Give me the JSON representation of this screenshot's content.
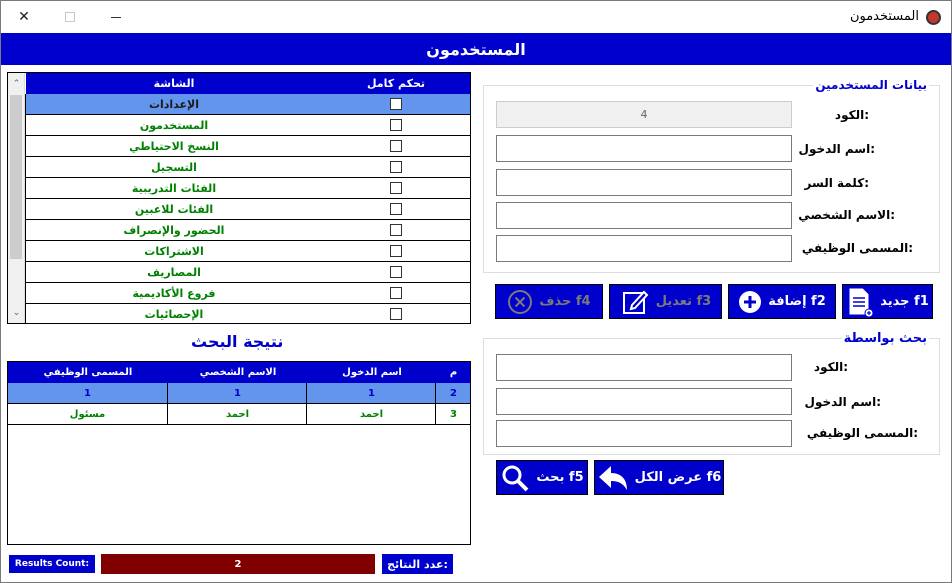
{
  "window": {
    "title": "المستخدمون",
    "close_glyph": "✕"
  },
  "header": {
    "title": "المستخدمون"
  },
  "permissions_grid": {
    "columns": {
      "screen": "الشاشة",
      "full_control": "تحكم كامل"
    },
    "rows": [
      {
        "screen": "الإعدادات",
        "selected": true
      },
      {
        "screen": "المستخدمون"
      },
      {
        "screen": "النسخ الاحتياطي"
      },
      {
        "screen": "التسجيل"
      },
      {
        "screen": "الفئات التدريبية"
      },
      {
        "screen": "الفئات للاعبين"
      },
      {
        "screen": "الحضور والإنصراف"
      },
      {
        "screen": "الاشتراكات"
      },
      {
        "screen": "المصاريف"
      },
      {
        "screen": "فروع الأكاديمية"
      },
      {
        "screen": "الإحصائيات"
      }
    ],
    "scroll_up_glyph": "⌃",
    "scroll_down_glyph": "⌄"
  },
  "search_result": {
    "title": "نتيجة البحث",
    "columns": {
      "job_title": "المسمى الوظيفي",
      "personal_name": "الاسم الشخصي",
      "login_name": "اسم الدخول",
      "index": "م"
    },
    "rows": [
      {
        "job_title": "1",
        "personal_name": "1",
        "login_name": "1",
        "index": "2",
        "selected": true
      },
      {
        "job_title": "مسئول",
        "personal_name": "احمد",
        "login_name": "احمد",
        "index": "3"
      }
    ]
  },
  "footer": {
    "results_count_label": "Results Count:",
    "results_count_value": "2",
    "results_count_ar": "عدد النتائج:"
  },
  "user_data": {
    "group_title": "بيانات المستخدمين",
    "code_label": "الكود:",
    "code_value": "4",
    "login_label": "اسم الدخول:",
    "password_label": "كلمة السر:",
    "personal_name_label": "الاسم الشخصي:",
    "job_title_label": "المسمى الوظيفي:"
  },
  "actions": {
    "new": "جديد f1",
    "add": "إضافة f2",
    "edit": "تعديل f3",
    "delete": "حذف f4"
  },
  "search_by": {
    "group_title": "بحث بواسطة",
    "code_label": "الكود:",
    "login_label": "اسم الدخول:",
    "job_title_label": "المسمى الوظيفي:"
  },
  "search_actions": {
    "show_all": "عرض الكل f6",
    "search": "بحث f5"
  },
  "colors": {
    "primary": "#0000cd",
    "selected_row": "#6495ed",
    "count_bg": "#800000",
    "green_text": "#008000"
  }
}
